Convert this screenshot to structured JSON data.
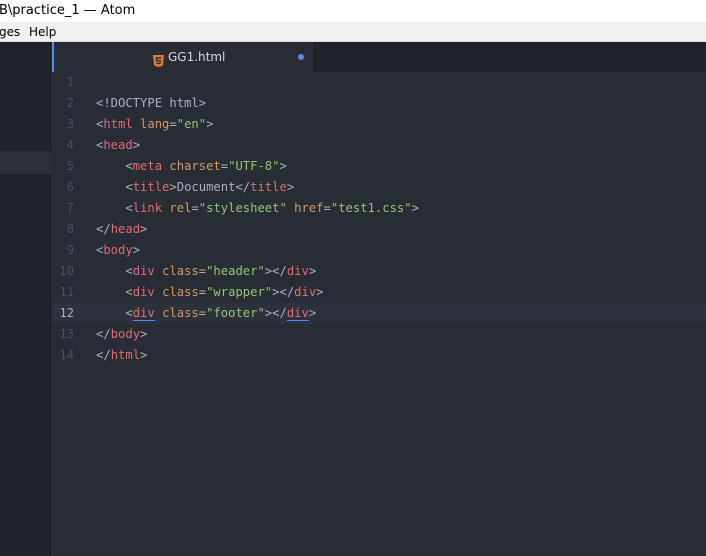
{
  "window": {
    "title": "B\\practice_1 — Atom"
  },
  "menubar": {
    "items": [
      "ges",
      "Help"
    ]
  },
  "tab": {
    "title": "GG1.html",
    "icon": "html5-icon",
    "modified": true
  },
  "colors": {
    "tag": "#e06c75",
    "attribute": "#d19a66",
    "string": "#98c379",
    "text": "#abb2bf",
    "accent": "#568af2"
  },
  "editor": {
    "cursor_line": 12,
    "line_numbers": [
      "1",
      "2",
      "3",
      "4",
      "5",
      "6",
      "7",
      "8",
      "9",
      "10",
      "11",
      "12",
      "13",
      "14"
    ],
    "lines": [
      [],
      [
        {
          "t": "pun",
          "v": "<!DOCTYPE html>"
        }
      ],
      [
        {
          "t": "pun",
          "v": "<"
        },
        {
          "t": "tag",
          "v": "html"
        },
        {
          "t": "txt",
          "v": " "
        },
        {
          "t": "attr",
          "v": "lang"
        },
        {
          "t": "pun",
          "v": "="
        },
        {
          "t": "str",
          "v": "\"en\""
        },
        {
          "t": "pun",
          "v": ">"
        }
      ],
      [
        {
          "t": "pun",
          "v": "<"
        },
        {
          "t": "tag",
          "v": "head"
        },
        {
          "t": "pun",
          "v": ">"
        }
      ],
      [
        {
          "t": "txt",
          "v": "    "
        },
        {
          "t": "pun",
          "v": "<"
        },
        {
          "t": "tag",
          "v": "meta"
        },
        {
          "t": "txt",
          "v": " "
        },
        {
          "t": "attr",
          "v": "charset"
        },
        {
          "t": "pun",
          "v": "="
        },
        {
          "t": "str",
          "v": "\"UTF-8\""
        },
        {
          "t": "pun",
          "v": ">"
        }
      ],
      [
        {
          "t": "txt",
          "v": "    "
        },
        {
          "t": "pun",
          "v": "<"
        },
        {
          "t": "tag",
          "v": "title"
        },
        {
          "t": "pun",
          "v": ">"
        },
        {
          "t": "txt",
          "v": "Document"
        },
        {
          "t": "pun",
          "v": "</"
        },
        {
          "t": "tag",
          "v": "title"
        },
        {
          "t": "pun",
          "v": ">"
        }
      ],
      [
        {
          "t": "txt",
          "v": "    "
        },
        {
          "t": "pun",
          "v": "<"
        },
        {
          "t": "tag",
          "v": "link"
        },
        {
          "t": "txt",
          "v": " "
        },
        {
          "t": "attr",
          "v": "rel"
        },
        {
          "t": "pun",
          "v": "="
        },
        {
          "t": "str",
          "v": "\"stylesheet\""
        },
        {
          "t": "txt",
          "v": " "
        },
        {
          "t": "attr",
          "v": "href"
        },
        {
          "t": "pun",
          "v": "="
        },
        {
          "t": "str",
          "v": "\"test1.css\""
        },
        {
          "t": "pun",
          "v": ">"
        }
      ],
      [
        {
          "t": "pun",
          "v": "</"
        },
        {
          "t": "tag",
          "v": "head"
        },
        {
          "t": "pun",
          "v": ">"
        }
      ],
      [
        {
          "t": "pun",
          "v": "<"
        },
        {
          "t": "tag",
          "v": "body"
        },
        {
          "t": "pun",
          "v": ">"
        }
      ],
      [
        {
          "t": "txt",
          "v": "    "
        },
        {
          "t": "pun",
          "v": "<"
        },
        {
          "t": "tag",
          "v": "div"
        },
        {
          "t": "txt",
          "v": " "
        },
        {
          "t": "attr",
          "v": "class"
        },
        {
          "t": "pun",
          "v": "="
        },
        {
          "t": "str",
          "v": "\"header\""
        },
        {
          "t": "pun",
          "v": "></"
        },
        {
          "t": "tag",
          "v": "div"
        },
        {
          "t": "pun",
          "v": ">"
        }
      ],
      [
        {
          "t": "txt",
          "v": "    "
        },
        {
          "t": "pun",
          "v": "<"
        },
        {
          "t": "tag",
          "v": "div"
        },
        {
          "t": "txt",
          "v": " "
        },
        {
          "t": "attr",
          "v": "class"
        },
        {
          "t": "pun",
          "v": "="
        },
        {
          "t": "str",
          "v": "\"wrapper\""
        },
        {
          "t": "pun",
          "v": "></"
        },
        {
          "t": "tag",
          "v": "div"
        },
        {
          "t": "pun",
          "v": ">"
        }
      ],
      [
        {
          "t": "txt",
          "v": "    "
        },
        {
          "t": "pun",
          "v": "<"
        },
        {
          "t": "tag",
          "v": "div",
          "m": true
        },
        {
          "t": "txt",
          "v": " "
        },
        {
          "t": "attr",
          "v": "class"
        },
        {
          "t": "pun",
          "v": "="
        },
        {
          "t": "str",
          "v": "\"footer\""
        },
        {
          "t": "pun",
          "v": "></"
        },
        {
          "t": "tag",
          "v": "div",
          "m": true
        },
        {
          "t": "pun",
          "v": ">"
        }
      ],
      [
        {
          "t": "pun",
          "v": "</"
        },
        {
          "t": "tag",
          "v": "body"
        },
        {
          "t": "pun",
          "v": ">"
        }
      ],
      [
        {
          "t": "pun",
          "v": "</"
        },
        {
          "t": "tag",
          "v": "html"
        },
        {
          "t": "pun",
          "v": ">"
        }
      ]
    ]
  }
}
